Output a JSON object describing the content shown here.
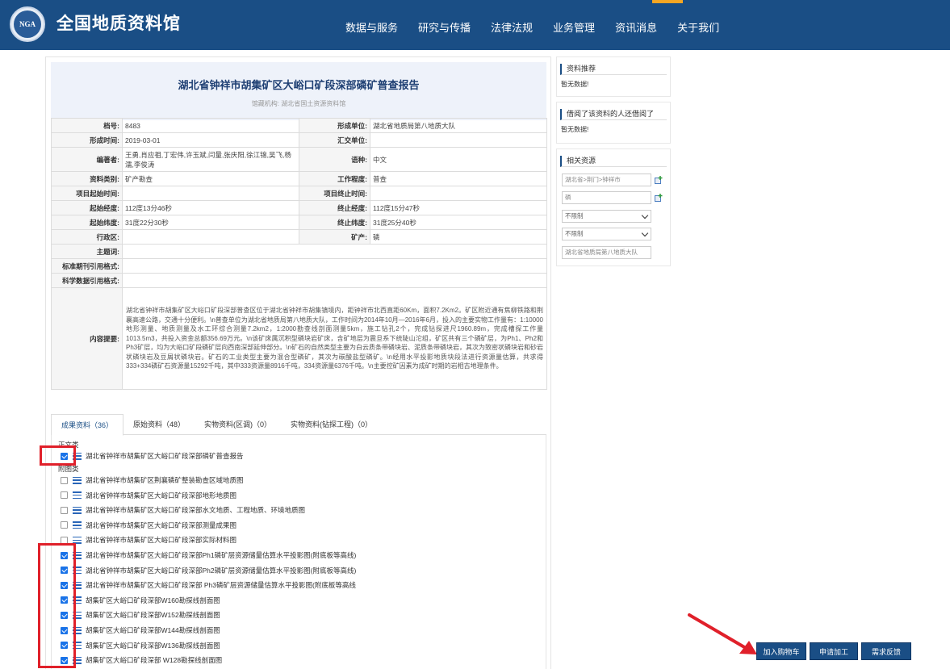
{
  "header": {
    "logo_text": "NGA",
    "site_title": "全国地质资料馆",
    "nav": [
      "数据与服务",
      "研究与传播",
      "法律法规",
      "业务管理",
      "资讯消息",
      "关于我们"
    ]
  },
  "document": {
    "title": "湖北省钟祥市胡集矿区大峪口矿段深部磷矿普查报告",
    "org_line": "馆藏机构:  湖北省国土资源资料馆"
  },
  "meta": {
    "archive_no_label": "档号:",
    "archive_no": "8483",
    "unit_label": "形成单位:",
    "unit": "湖北省地质局第八地质大队",
    "formed_time_label": "形成时间:",
    "formed_time": "2019-03-01",
    "submit_unit_label": "汇交单位:",
    "submit_unit": "",
    "authors_label": "编著者:",
    "authors": "王勇,肖应祖,丁宏伟,许玉斌,闫量,张庆阳,徐江锦,吴飞,杨濡,李俊涛",
    "language_label": "语种:",
    "language": "中文",
    "category_label": "资料类别:",
    "category": "矿产勘查",
    "work_level_label": "工作程度:",
    "work_level": "普查",
    "proj_start_label": "项目起始时间:",
    "proj_start": "",
    "proj_end_label": "项目终止时间:",
    "proj_end": "",
    "start_lon_label": "起始经度:",
    "start_lon": "112度13分46秒",
    "end_lon_label": "终止经度:",
    "end_lon": "112度15分47秒",
    "start_lat_label": "起始纬度:",
    "start_lat": "31度22分30秒",
    "end_lat_label": "终止纬度:",
    "end_lat": "31度25分40秒",
    "admin_label": "行政区:",
    "admin": "",
    "mineral_label": "矿产:",
    "mineral": "磷",
    "subject_label": "主题词:",
    "subject": "",
    "journal_cite_label": "标准期刊引用格式:",
    "journal_cite": "",
    "science_cite_label": "科学数据引用格式:",
    "science_cite": "",
    "abstract_label": "内容提要:",
    "abstract": "湖北省钟祥市胡集矿区大峪口矿段深部普查区位于湖北省钟祥市胡集镇境内，距钟祥市北西直距60Km，面积7.2Km2。矿区附近通有焦柳铁路和荆襄高速公路，交通十分便利。\\n普查单位为湖北省地质局第八地质大队，工作时间为2014年10月—2016年6月，投入的主要实物工作量有：1:10000地形测量、地质测量及水工环综合测量7.2km2，1:2000勘查线剖面测量5km，施工钻孔2个，完成钻探进尺1960.89m，完成槽探工作量1013.5m3，共投入资金总额356.69万元。\\n该矿床属沉积型磷块岩矿床，含矿地层为震旦系下统陡山沱组，矿区共有三个磷矿层，为Ph1、Ph2和Ph3矿层，均为大峪口矿段磷矿层向西南深部延伸部分。\\n矿石的自然类型主要为白云质条带磷块岩、泥质条带磷块岩，其次为致密状磷块岩和砂岩状磷块岩及豆屑状磷块岩。矿石的工业类型主要为混合型磷矿，其次为碳酸盐型磷矿。\\n经用水平投影地质块段法进行资源量估算，共求得333+334磷矿石资源量15292千吨，其中333资源量8916千吨，334资源量6376千吨。\\n主要控矿因素为成矿时期的岩相古地理条件。"
  },
  "tabs": [
    "成果资料（36）",
    "原始资料（48）",
    "实物资料(区调)（0）",
    "实物资料(钻探工程)（0）"
  ],
  "groups": {
    "main_text": "正文类",
    "attachments": "附图类"
  },
  "files": [
    {
      "name": "湖北省钟祥市胡集矿区大峪口矿段深部磷矿普查报告",
      "checked": true
    },
    {
      "name": "湖北省钟祥市胡集矿区荆襄磷矿整装勘查区域地质图",
      "checked": false
    },
    {
      "name": "湖北省钟祥市胡集矿区大峪口矿段深部地形地质图",
      "checked": false
    },
    {
      "name": "湖北省钟祥市胡集矿区大峪口矿段深部水文地质、工程地质、环境地质图",
      "checked": false
    },
    {
      "name": "湖北省钟祥市胡集矿区大峪口矿段深部测量成果图",
      "checked": false
    },
    {
      "name": "湖北省钟祥市胡集矿区大峪口矿段深部实际材料图",
      "checked": false
    },
    {
      "name": "湖北省钟祥市胡集矿区大峪口矿段深部Ph1磷矿层资源储量估算水平投影图(附底板等高线)",
      "checked": true
    },
    {
      "name": "湖北省钟祥市胡集矿区大峪口矿段深部Ph2磷矿层资源储量估算水平投影图(附底板等高线)",
      "checked": true
    },
    {
      "name": "湖北省钟祥市胡集矿区大峪口矿段深部 Ph3磷矿层资源储量估算水平投影图(附底板等高线",
      "checked": true
    },
    {
      "name": "胡集矿区大峪口矿段深部W160勘探线剖面图",
      "checked": true
    },
    {
      "name": "胡集矿区大峪口矿段深部W152勘探线剖面图",
      "checked": true
    },
    {
      "name": "胡集矿区大峪口矿段深部W144勘探线剖面图",
      "checked": true
    },
    {
      "name": "胡集矿区大峪口矿段深部W136勘探线剖面图",
      "checked": true
    },
    {
      "name": "胡集矿区大峪口矿段深部 W128勘探线剖面图",
      "checked": true
    }
  ],
  "sidebar": {
    "recommend_title": "资料推荐",
    "recommend_empty": "暂无数据!",
    "also_title": "借阅了该资料的人还借阅了",
    "also_empty": "暂无数据!",
    "related_title": "相关资源",
    "region_input": "湖北省>荆门>钟祥市",
    "mineral_input": "磷",
    "select1": "不限制",
    "select2": "不限制",
    "unit_input": "湖北省地质局第八地质大队"
  },
  "buttons": {
    "cart": "加入购物车",
    "apply": "申请加工",
    "feedback": "需求反馈"
  },
  "colors": {
    "header_bg": "#1a4e85",
    "highlight": "#e0202a",
    "accent": "#f5a623"
  }
}
